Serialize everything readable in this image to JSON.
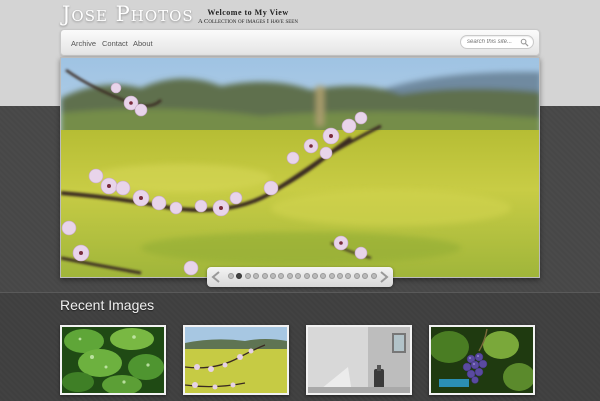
{
  "site": {
    "title": "Jose Photos",
    "tagline_line1": "Welcome to My View",
    "tagline_line2": "A Collection of images I have seen"
  },
  "nav": {
    "items": [
      {
        "label": "Archive"
      },
      {
        "label": "Contact"
      },
      {
        "label": "About"
      }
    ]
  },
  "search": {
    "placeholder": "search this site..."
  },
  "slider": {
    "total_slides": 18,
    "active_index": 1
  },
  "recent": {
    "heading": "Recent Images",
    "thumbnails": [
      {
        "subject": "green-leaves-with-water-drops"
      },
      {
        "subject": "cherry-blossoms-over-meadow"
      },
      {
        "subject": "white-room-interior"
      },
      {
        "subject": "purple-grapes-on-vine"
      }
    ]
  },
  "colors": {
    "header_background": "#d4d4d4",
    "dark_band": "#4a4a4a",
    "meadow": "#c2c73d",
    "blossom": "#e6d2e6"
  }
}
